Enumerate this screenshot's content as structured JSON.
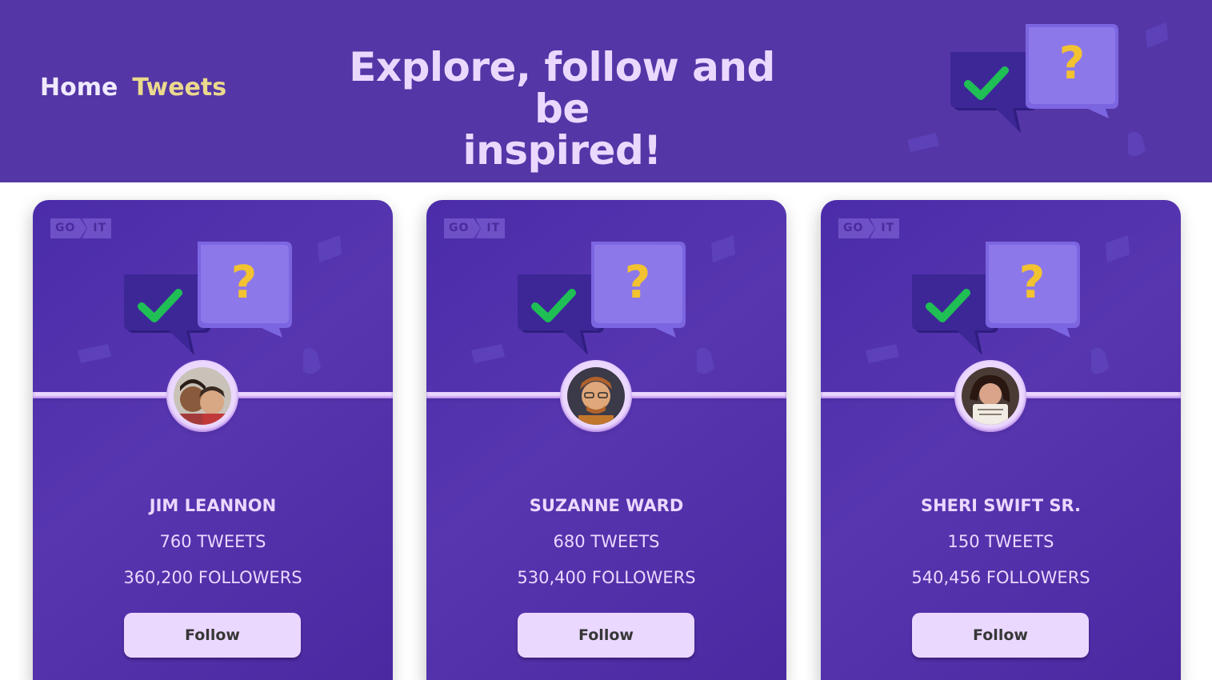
{
  "nav": {
    "home_label": "Home",
    "tweets_label": "Tweets"
  },
  "hero": {
    "title_line1": "Explore, follow and be",
    "title_line2": "inspired!"
  },
  "colors": {
    "header_bg": "#5436a6",
    "active_nav": "#ebd98d",
    "card_text": "#ebd8ff",
    "button_bg": "#ebd8ff",
    "button_text": "#373737"
  },
  "card_logo": {
    "left": "GO",
    "right": "IT"
  },
  "cards": [
    {
      "name": "JIM LEANNON",
      "tweets": "760 TWEETS",
      "followers": "360,200 FOLLOWERS",
      "button_label": "Follow",
      "avatar_icon": "user-photo-avatar"
    },
    {
      "name": "SUZANNE WARD",
      "tweets": "680 TWEETS",
      "followers": "530,400 FOLLOWERS",
      "button_label": "Follow",
      "avatar_icon": "user-photo-avatar"
    },
    {
      "name": "SHERI SWIFT SR.",
      "tweets": "150 TWEETS",
      "followers": "540,456 FOLLOWERS",
      "button_label": "Follow",
      "avatar_icon": "user-photo-avatar"
    }
  ]
}
